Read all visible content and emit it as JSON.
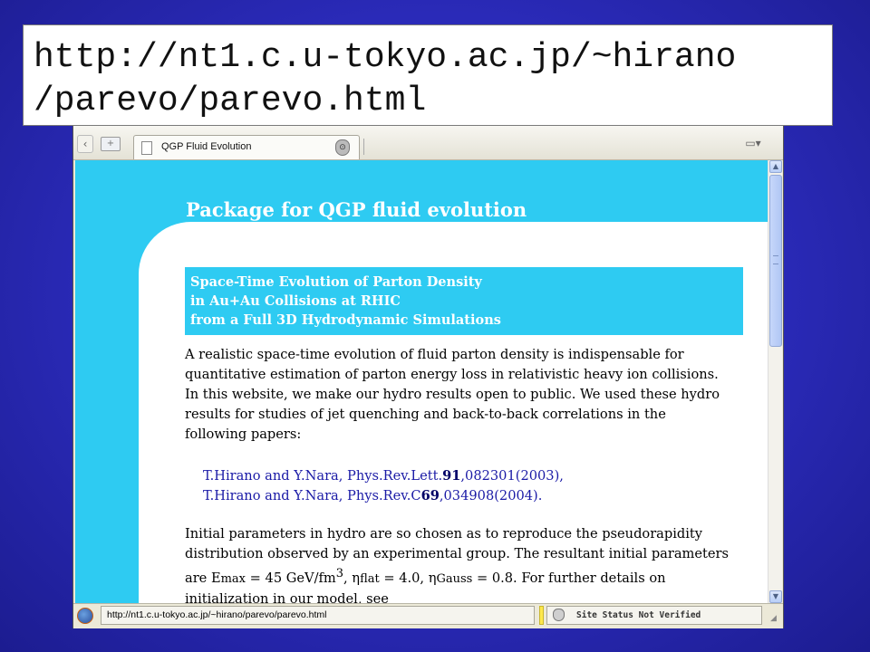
{
  "banner": {
    "line1": "http://nt1.c.u-tokyo.ac.jp/~hirano",
    "line2": "/parevo/parevo.html"
  },
  "browser": {
    "tab": {
      "label": "QGP Fluid Evolution"
    },
    "statusbar": {
      "url": "http://nt1.c.u-tokyo.ac.jp/~hirano/parevo/parevo.html",
      "site_status": "Site Status Not Verified"
    },
    "icons": {
      "back": "chevron-left-icon",
      "new_tab": "new-tab-icon",
      "page": "page-icon",
      "shield": "shield-icon",
      "tab_list": "tab-list-icon",
      "firefox": "firefox-icon"
    }
  },
  "page": {
    "title": "Package for QGP fluid evolution",
    "subtitle": {
      "line1": "Space-Time Evolution of Parton Density",
      "line2": "in Au+Au Collisions at RHIC",
      "line3": "from a Full 3D Hydrodynamic Simulations"
    },
    "intro": {
      "line1": "A realistic space-time evolution of fluid parton density is indispensable for",
      "line2": "quantitative estimation of parton energy loss in relativistic heavy ion collisions.",
      "line3": "In this website, we make our hydro results open to public. We used these hydro",
      "line4": "results for studies of jet quenching and back-to-back correlations in the",
      "line5": "following papers:"
    },
    "refs": [
      {
        "pre": "T.Hirano and Y.Nara, Phys.Rev.Lett.",
        "vol": "91",
        "post": ",082301(2003),"
      },
      {
        "pre": "T.Hirano and Y.Nara, Phys.Rev.C",
        "vol": "69",
        "post": ",034908(2004)."
      }
    ],
    "params": {
      "line1": "Initial parameters in hydro are so chosen as to reproduce the pseudorapidity",
      "line2": "distribution observed by an experimental group. The resultant initial parameters",
      "line3_a": "are E",
      "line3_emax_sub": "max",
      "line3_b": " = 45 GeV/fm",
      "line3_cube": "3",
      "line3_c": ", η",
      "line3_flat_sub": "flat",
      "line3_d": " = 4.0, η",
      "line3_gauss_sub": "Gauss",
      "line3_e": " = 0.8. For further details on",
      "line4": "initialization in our model, see"
    }
  },
  "colors": {
    "page_cyan": "#2ecbf2",
    "link_blue": "#1a1aa6",
    "slide_blue": "#2a2ab8"
  }
}
